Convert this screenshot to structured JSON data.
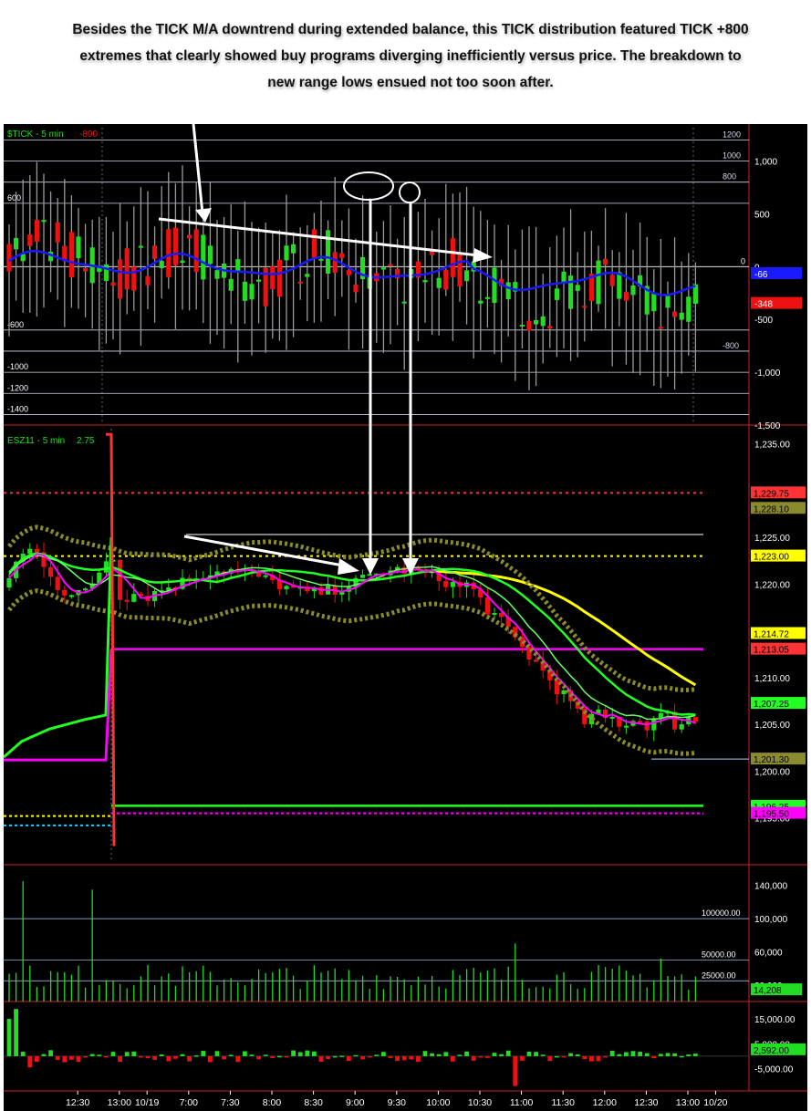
{
  "annotation": {
    "line1": "Besides the TICK M/A downtrend during extended balance, this TICK distribution featured TICK +800",
    "line2": "extremes that clearly showed buy programs diverging inefficiently versus price.  The breakdown to",
    "line3": "new range lows ensued not too soon after."
  },
  "colors": {
    "background": "#000000",
    "up_bar": "#22dd22",
    "down_bar": "#ee1111",
    "tick_ma": "#1a1aff",
    "divider": "#cc2222",
    "grid": "#cfd8e8",
    "yellow_level": "#ffff00",
    "magenta_level": "#ff00ff",
    "green_level": "#22ff22",
    "red_level": "#ff3333",
    "band": "#8a8a2e"
  },
  "chart_data": [
    {
      "type": "candlestick",
      "panel": "tick",
      "title": "$TICK - 5 min",
      "last_value": "-890",
      "ylim": [
        -1500,
        1350
      ],
      "right_ticks": [
        "1,000",
        "500",
        "0",
        "-500",
        "-1,000",
        "-1,500"
      ],
      "right_tick_values": [
        1000,
        500,
        0,
        -500,
        -1000,
        -1500
      ],
      "lines": [
        {
          "value": 1200,
          "label": "1200",
          "side": "right"
        },
        {
          "value": 1000,
          "label": "1000",
          "side": "right"
        },
        {
          "value": 800,
          "label": "800",
          "side": "right"
        },
        {
          "value": 600,
          "label": "600",
          "side": "left"
        },
        {
          "value": -600,
          "label": "-600",
          "side": "left"
        },
        {
          "value": -800,
          "label": "-800",
          "side": "right"
        },
        {
          "value": -1000,
          "label": "-1000",
          "side": "left"
        },
        {
          "value": -1200,
          "label": "-1200",
          "side": "left"
        },
        {
          "value": -1400,
          "label": "-1400",
          "side": "left"
        }
      ],
      "badges": [
        {
          "value": -66,
          "label": "-66",
          "color": "#1a1aff"
        },
        {
          "value": -348,
          "label": "-348",
          "color": "#ee1111"
        }
      ],
      "ma_label": "TICK M/A"
    },
    {
      "type": "candlestick",
      "panel": "price",
      "title": "ESZ11 - 5 min",
      "last_value": "2.75",
      "ylim": [
        1190,
        1237
      ],
      "right_ticks": [
        "1,235.00",
        "1,230.00",
        "1,225.00",
        "1,220.00",
        "1,215.00",
        "1,210.00",
        "1,205.00",
        "1,200.00",
        "1,195.00"
      ],
      "right_tick_values": [
        1235,
        1230,
        1225,
        1220,
        1215,
        1210,
        1205,
        1200,
        1195
      ],
      "levels": [
        {
          "value": 1229.75,
          "label": "1,229.75",
          "color": "#ff3333",
          "style": "dotted"
        },
        {
          "value": 1228.1,
          "label": "1,228.10",
          "color": "#8a8a2e",
          "style": "badge"
        },
        {
          "value": 1223.0,
          "label": "1,223.00",
          "color": "#ffff00",
          "style": "dotted"
        },
        {
          "value": 1214.72,
          "label": "1,214.72",
          "color": "#ffff00",
          "style": "badge"
        },
        {
          "value": 1213.05,
          "label": "1,213.05",
          "color": "#ff3333",
          "style": "badge"
        },
        {
          "value": 1207.25,
          "label": "1,207.25",
          "color": "#22ff22",
          "style": "badge"
        },
        {
          "value": 1201.3,
          "label": "1,201.30",
          "color": "#8a8a2e",
          "style": "badge"
        },
        {
          "value": 1196.25,
          "label": "1,196.25",
          "color": "#22ff22",
          "style": "badge"
        },
        {
          "value": 1195.5,
          "label": "1,195.50",
          "color": "#ff00ff",
          "style": "badge"
        }
      ]
    },
    {
      "type": "bar",
      "panel": "volume",
      "right_ticks": [
        "140,000",
        "100,000",
        "60,000",
        "20,000"
      ],
      "right_tick_values": [
        140000,
        100000,
        60000,
        20000
      ],
      "ylim": [
        0,
        165000
      ],
      "lines": [
        {
          "value": 100000,
          "label": "100000.00"
        },
        {
          "value": 50000,
          "label": "50000.00"
        },
        {
          "value": 25000,
          "label": "25000.00"
        }
      ],
      "last_value": "14,208"
    },
    {
      "type": "bar",
      "panel": "delta",
      "right_ticks": [
        "15,000.00",
        "5,000.00",
        "-5,000.00"
      ],
      "right_tick_values": [
        15000,
        5000,
        -5000
      ],
      "ylim": [
        -14000,
        22000
      ],
      "last_value": "2,592.00"
    }
  ],
  "x_axis": {
    "labels": [
      "12:30",
      "13:00",
      "10/19",
      "7:00",
      "7:30",
      "8:00",
      "8:30",
      "9:00",
      "9:30",
      "10:00",
      "10:30",
      "11:00",
      "11:30",
      "12:00",
      "12:30",
      "13:00",
      "10/20"
    ],
    "bar_index": [
      7,
      13,
      17,
      23,
      29,
      35,
      41,
      47,
      53,
      59,
      65,
      71,
      77,
      83,
      89,
      95,
      99
    ]
  }
}
